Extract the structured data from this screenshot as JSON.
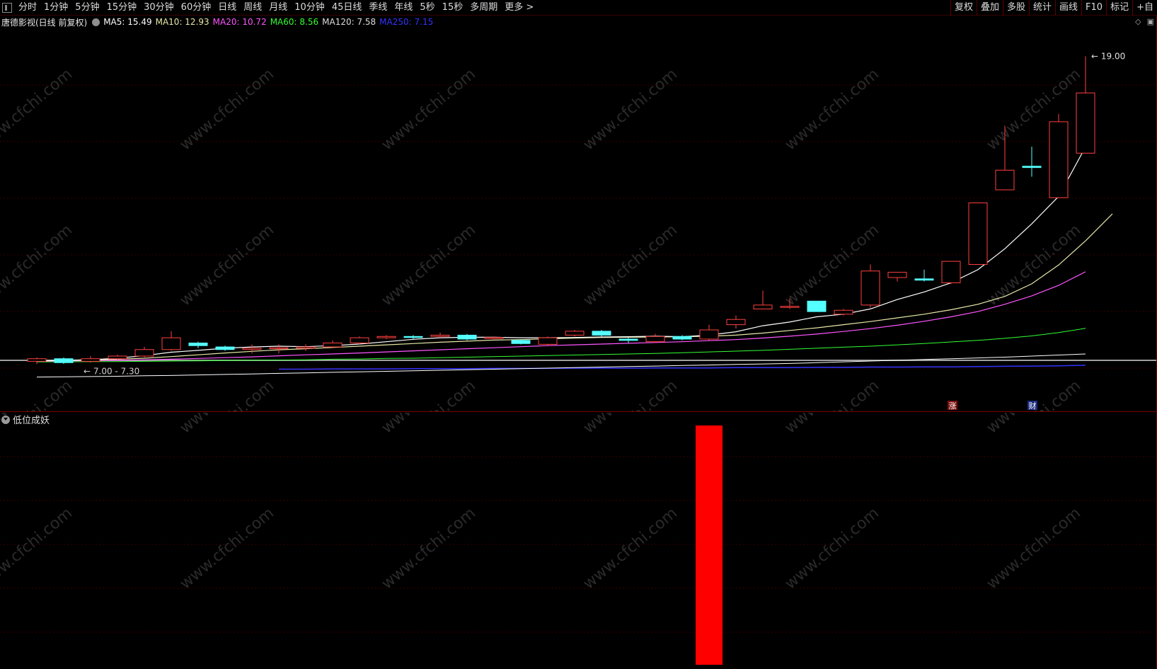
{
  "toolbar": {
    "periods": [
      "分时",
      "1分钟",
      "5分钟",
      "15分钟",
      "30分钟",
      "60分钟",
      "日线",
      "周线",
      "月线",
      "10分钟",
      "45日线",
      "季线",
      "年线",
      "5秒",
      "15秒",
      "多周期",
      "更多 >"
    ],
    "actions": [
      "复权",
      "叠加",
      "多股",
      "统计",
      "画线",
      "F10",
      "标记",
      "+自"
    ]
  },
  "info": {
    "stock": "唐德影视(日线 前复权)",
    "ma5": "MA5: 15.49",
    "ma10": "MA10: 12.93",
    "ma20": "MA20: 10.72",
    "ma60": "MA60: 8.56",
    "ma120": "MA120: 7.58",
    "ma250": "MA250: 7.15"
  },
  "colors": {
    "ma5": "#ffffff",
    "ma10": "#e8e8a8",
    "ma20": "#ff55ff",
    "ma60": "#33ff33",
    "ma120": "#ffffff",
    "ma250": "#3333ff",
    "up": "#ff4040",
    "down": "#54ffff",
    "signal": "#ff0000"
  },
  "labels": {
    "high_price": "19.00",
    "low_price": "7.00",
    "low_price2": "7.30",
    "badge_zhang": "涨",
    "badge_cai": "财"
  },
  "watermark": "www.cfchi.com",
  "indicator": {
    "name": "低位成妖"
  },
  "chart_data": {
    "type": "candlestick",
    "ylim": [
      6.5,
      19.8
    ],
    "candles": [
      [
        7.3,
        7.4,
        7.2,
        7.45
      ],
      [
        7.4,
        7.25,
        7.2,
        7.45
      ],
      [
        7.3,
        7.4,
        7.25,
        7.5
      ],
      [
        7.4,
        7.5,
        7.35,
        7.55
      ],
      [
        7.5,
        7.75,
        7.45,
        7.85
      ],
      [
        7.75,
        8.2,
        7.7,
        8.45
      ],
      [
        8.0,
        7.9,
        7.8,
        8.05
      ],
      [
        7.85,
        7.75,
        7.7,
        7.9
      ],
      [
        7.75,
        7.8,
        7.6,
        7.95
      ],
      [
        7.8,
        7.82,
        7.6,
        7.95
      ],
      [
        7.8,
        7.85,
        7.7,
        7.95
      ],
      [
        7.85,
        8.0,
        7.8,
        8.1
      ],
      [
        8.0,
        8.2,
        7.95,
        8.25
      ],
      [
        8.2,
        8.25,
        8.15,
        8.3
      ],
      [
        8.25,
        8.22,
        8.15,
        8.3
      ],
      [
        8.25,
        8.3,
        8.2,
        8.4
      ],
      [
        8.3,
        8.15,
        8.1,
        8.35
      ],
      [
        8.2,
        8.21,
        8.15,
        8.25
      ],
      [
        8.1,
        7.98,
        7.95,
        8.15
      ],
      [
        7.95,
        8.2,
        7.9,
        8.25
      ],
      [
        8.3,
        8.45,
        8.25,
        8.5
      ],
      [
        8.45,
        8.3,
        8.25,
        8.5
      ],
      [
        8.15,
        8.1,
        8.0,
        8.2
      ],
      [
        8.05,
        8.25,
        8.0,
        8.35
      ],
      [
        8.25,
        8.15,
        8.1,
        8.3
      ],
      [
        8.15,
        8.5,
        8.1,
        8.7
      ],
      [
        8.7,
        8.9,
        8.55,
        9.05
      ],
      [
        9.3,
        9.45,
        9.3,
        10.0
      ],
      [
        9.4,
        9.4,
        9.3,
        9.7
      ],
      [
        9.6,
        9.2,
        9.2,
        9.6
      ],
      [
        9.1,
        9.25,
        9.05,
        9.3
      ],
      [
        9.45,
        10.75,
        9.35,
        11.0
      ],
      [
        10.5,
        10.7,
        10.35,
        10.7
      ],
      [
        10.45,
        10.4,
        10.35,
        10.8
      ],
      [
        10.3,
        11.12,
        10.25,
        11.12
      ],
      [
        11.0,
        13.35,
        11.0,
        13.35
      ],
      [
        13.85,
        14.6,
        13.85,
        16.3
      ],
      [
        14.75,
        14.7,
        14.35,
        15.5
      ],
      [
        13.55,
        16.45,
        13.55,
        16.75
      ],
      [
        15.25,
        17.55,
        15.25,
        18.95
      ]
    ],
    "ma5": [
      7.32,
      7.34,
      7.36,
      7.42,
      7.52,
      7.65,
      7.72,
      7.8,
      7.85,
      7.88,
      7.86,
      7.9,
      7.96,
      8.05,
      8.14,
      8.2,
      8.22,
      8.22,
      8.2,
      8.2,
      8.21,
      8.23,
      8.24,
      8.26,
      8.24,
      8.3,
      8.43,
      8.66,
      8.8,
      9.0,
      9.1,
      9.3,
      9.66,
      9.95,
      10.3,
      10.8,
      11.6,
      12.55,
      13.6,
      15.49
    ],
    "ma10": [
      7.31,
      7.33,
      7.35,
      7.38,
      7.42,
      7.48,
      7.55,
      7.62,
      7.68,
      7.74,
      7.78,
      7.83,
      7.88,
      7.93,
      7.98,
      8.03,
      8.07,
      8.11,
      8.13,
      8.16,
      8.19,
      8.21,
      8.22,
      8.23,
      8.24,
      8.26,
      8.3,
      8.38,
      8.48,
      8.58,
      8.7,
      8.82,
      8.96,
      9.1,
      9.27,
      9.48,
      9.78,
      10.26,
      10.98,
      11.9,
      12.93
    ],
    "ma20": [
      7.3,
      7.31,
      7.33,
      7.34,
      7.36,
      7.38,
      7.41,
      7.44,
      7.47,
      7.51,
      7.55,
      7.58,
      7.62,
      7.66,
      7.7,
      7.74,
      7.78,
      7.82,
      7.86,
      7.9,
      7.93,
      7.96,
      7.99,
      8.02,
      8.05,
      8.09,
      8.13,
      8.19,
      8.26,
      8.34,
      8.44,
      8.55,
      8.68,
      8.83,
      9.0,
      9.2,
      9.48,
      9.8,
      10.2,
      10.72
    ],
    "ma60": [
      7.28,
      7.28,
      7.29,
      7.29,
      7.3,
      7.31,
      7.32,
      7.33,
      7.34,
      7.35,
      7.36,
      7.38,
      7.39,
      7.41,
      7.42,
      7.44,
      7.46,
      7.48,
      7.5,
      7.52,
      7.54,
      7.56,
      7.58,
      7.6,
      7.63,
      7.66,
      7.69,
      7.72,
      7.76,
      7.8,
      7.84,
      7.88,
      7.93,
      7.98,
      8.04,
      8.1,
      8.18,
      8.27,
      8.4,
      8.56
    ],
    "ma120": [
      6.7,
      6.71,
      6.72,
      6.73,
      6.75,
      6.76,
      6.78,
      6.8,
      6.82,
      6.84,
      6.86,
      6.88,
      6.9,
      6.92,
      6.94,
      6.96,
      6.98,
      7.0,
      7.02,
      7.04,
      7.06,
      7.08,
      7.1,
      7.12,
      7.14,
      7.16,
      7.18,
      7.2,
      7.22,
      7.25,
      7.28,
      7.31,
      7.34,
      7.37,
      7.4,
      7.43,
      7.46,
      7.5,
      7.54,
      7.58
    ],
    "ma250": [
      null,
      null,
      null,
      null,
      null,
      null,
      null,
      null,
      null,
      7.0,
      7.0,
      7.01,
      7.01,
      7.01,
      7.02,
      7.02,
      7.02,
      7.03,
      7.03,
      7.03,
      7.04,
      7.04,
      7.04,
      7.05,
      7.05,
      7.05,
      7.06,
      7.06,
      7.06,
      7.07,
      7.07,
      7.08,
      7.08,
      7.09,
      7.09,
      7.1,
      7.11,
      7.12,
      7.13,
      7.15
    ],
    "signal_index": 25,
    "signal_value": 1
  }
}
